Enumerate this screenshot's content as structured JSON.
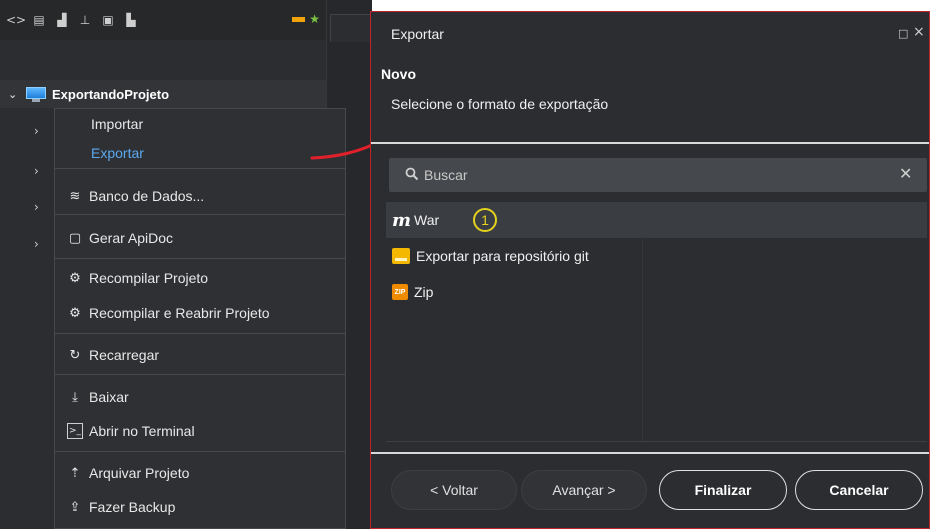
{
  "tree": {
    "project_name": "ExportandoProjeto"
  },
  "context_menu": {
    "importar": "Importar",
    "exportar": "Exportar",
    "banco": "Banco de Dados...",
    "apidoc": "Gerar ApiDoc",
    "recompilar": "Recompilar Projeto",
    "recompilar_reabrir": "Recompilar e Reabrir Projeto",
    "recarregar": "Recarregar",
    "baixar": "Baixar",
    "terminal": "Abrir no Terminal",
    "arquivar": "Arquivar Projeto",
    "backup": "Fazer Backup"
  },
  "dialog": {
    "title": "Exportar",
    "heading": "Novo",
    "description": "Selecione o formato de exportação",
    "search_placeholder": "Buscar",
    "options": [
      "War",
      "Exportar para repositório git",
      "Zip"
    ],
    "selected": "War",
    "step_badge": "1",
    "buttons": {
      "back": "< Voltar",
      "next": "Avançar >",
      "finish": "Finalizar",
      "cancel": "Cancelar"
    }
  },
  "colors": {
    "dialog_border": "#c0232c",
    "highlight_link": "#5aa9f0",
    "annotation_arrow": "#e0202a",
    "step_badge": "#e4d21d"
  },
  "icons": [
    "code-icon",
    "file-icon",
    "chart-icon",
    "hierarchy-icon",
    "html5-icon",
    "tools-icon",
    "database-icon",
    "apidoc-icon",
    "gears-icon",
    "reload-icon",
    "download-icon",
    "terminal-icon",
    "archive-icon",
    "backup-icon",
    "search-icon",
    "close-icon",
    "maximize-icon"
  ]
}
